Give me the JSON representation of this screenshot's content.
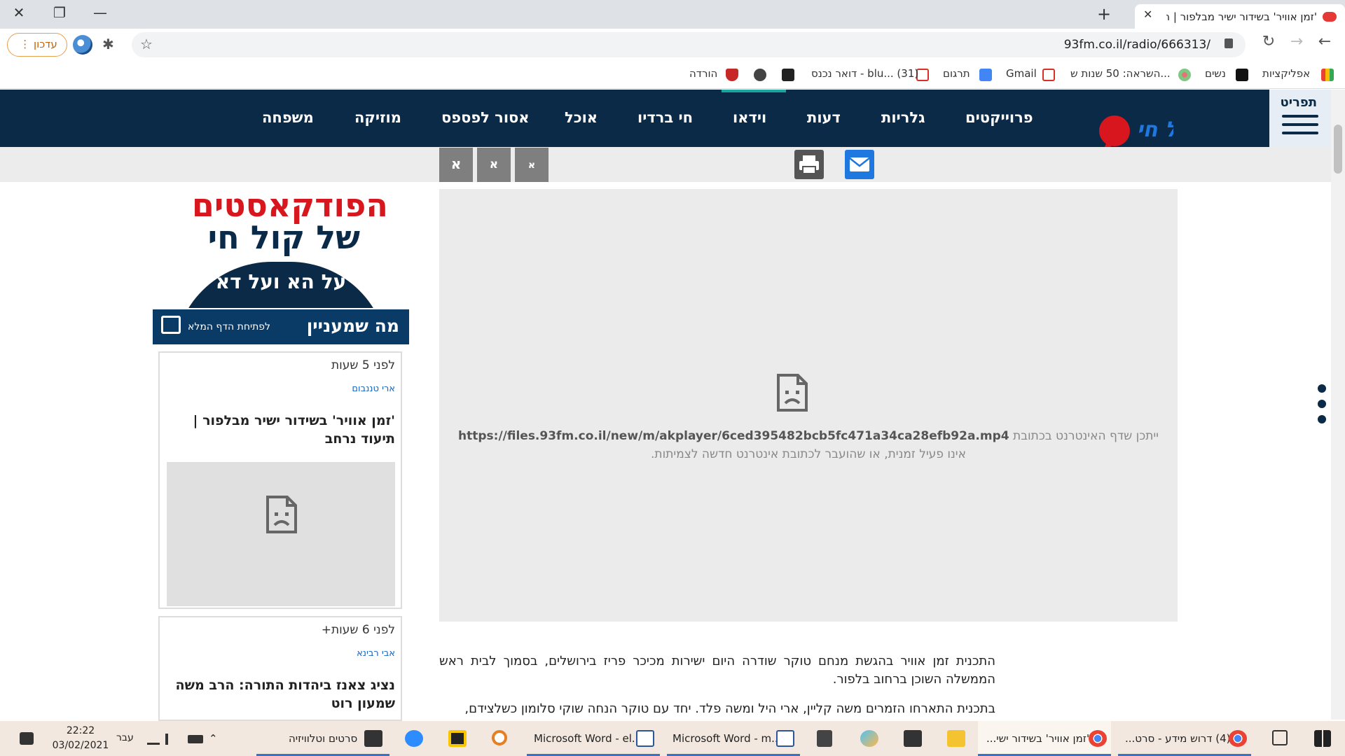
{
  "browser": {
    "tab_title": "'זמן אוויר' בשידור ישיר מבלפור | ה",
    "url": "93fm.co.il/radio/666313/",
    "update_label": "עדכון",
    "bookmarks": [
      "אפליקציות",
      "נשים",
      "השראה: 50 שנות ש...",
      "Gmail",
      "תרגום",
      "דואר נכנס - blu... (31)",
      "הורדה"
    ]
  },
  "site": {
    "menu_label": "תפריט",
    "logo_text": "קול חי",
    "nav": [
      "פרוייקטים",
      "גלריות",
      "דעות",
      "וידאו",
      "חי ברדיו",
      "אוכל",
      "אסור לפספס",
      "מוזיקה",
      "משפחה"
    ],
    "font_buttons": [
      "א",
      "א",
      "א"
    ]
  },
  "sidebar": {
    "podcast_line1": "הפודקאסטים",
    "podcast_line2": "של קול חי",
    "podcast_line3": "על הא ועל דא",
    "interest_title": "מה שמעניין",
    "interest_link": "לפתיחת הדף המלא",
    "cards": [
      {
        "time": "לפני 5 שעות",
        "author": "ארי טננבום",
        "title": "'זמן אוויר' בשידור ישיר מבלפור | תיעוד נרחב"
      },
      {
        "time": "לפני 6 שעות+",
        "author": "אבי רבינא",
        "title": "נציג צאנז ביהדות התורה: הרב משה שמעון רוט"
      }
    ]
  },
  "video_error": {
    "prefix": "ייתכן שדף האינטרנט בכתובת",
    "url": "https://files.93fm.co.il/new/m/akplayer/6ced395482bcb5fc471a34ca28efb92a.mp4",
    "suffix": "אינו פעיל זמנית, או שהועבר לכתובת אינטרנט חדשה לצמיתות."
  },
  "article": {
    "p1": "התכנית זמן אוויר בהגשת מנחם טוקר שודרה היום ישירות מכיכר פריז בירושלים, בסמוך לבית ראש הממשלה השוכן ברחוב בלפור.",
    "p2": "בתכנית התארחו הזמרים משה קליין, ארי היל ומשה פלד. יחד עם טוקר הנחה שוקי סלומון כשלצידם,"
  },
  "taskbar": {
    "time": "22:22",
    "date": "03/02/2021",
    "lang": "עבר",
    "items": [
      "סרטים וטלוויזיה",
      "Microsoft Word - el...",
      "Microsoft Word - m...",
      "'זמן אוויר' בשידור ישי...",
      "(4) דרוש מידע - סרט..."
    ]
  }
}
